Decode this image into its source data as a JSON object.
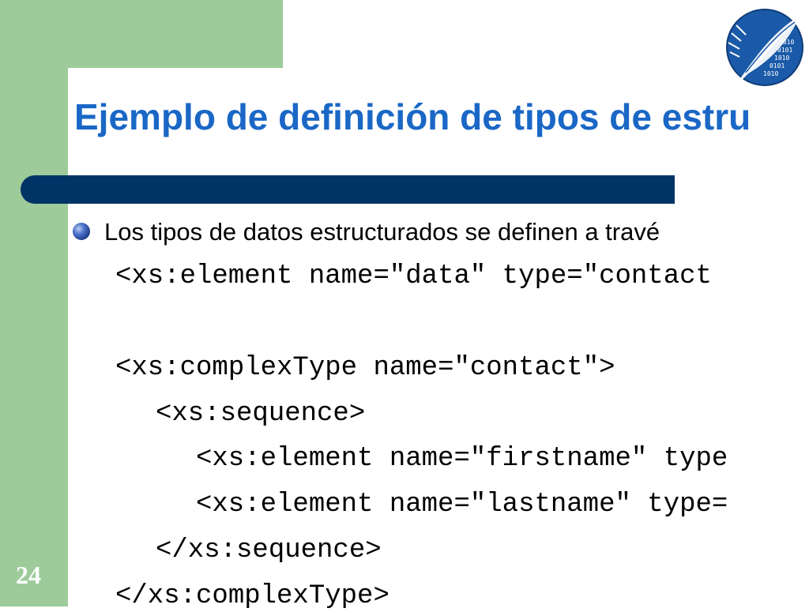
{
  "slide": {
    "title": "Ejemplo de definición de tipos de estru",
    "bullet": "Los tipos de datos estructurados se definen a travé",
    "code_lines": [
      "<xs:element name=\"data\" type=\"contact",
      "<xs:complexType name=\"contact\">",
      "<xs:sequence>",
      "<xs:element name=\"firstname\" type",
      "<xs:element name=\"lastname\" type=",
      "</xs:sequence>",
      "</xs:complexType>"
    ],
    "page_number": "24",
    "logo_digits": [
      "1010",
      "0101",
      "1010",
      "0101",
      "1010"
    ]
  },
  "colors": {
    "green": "#9dcb9a",
    "title_blue": "#1a67c6",
    "bar_navy": "#003466",
    "logo_blue": "#1a5aa8"
  }
}
